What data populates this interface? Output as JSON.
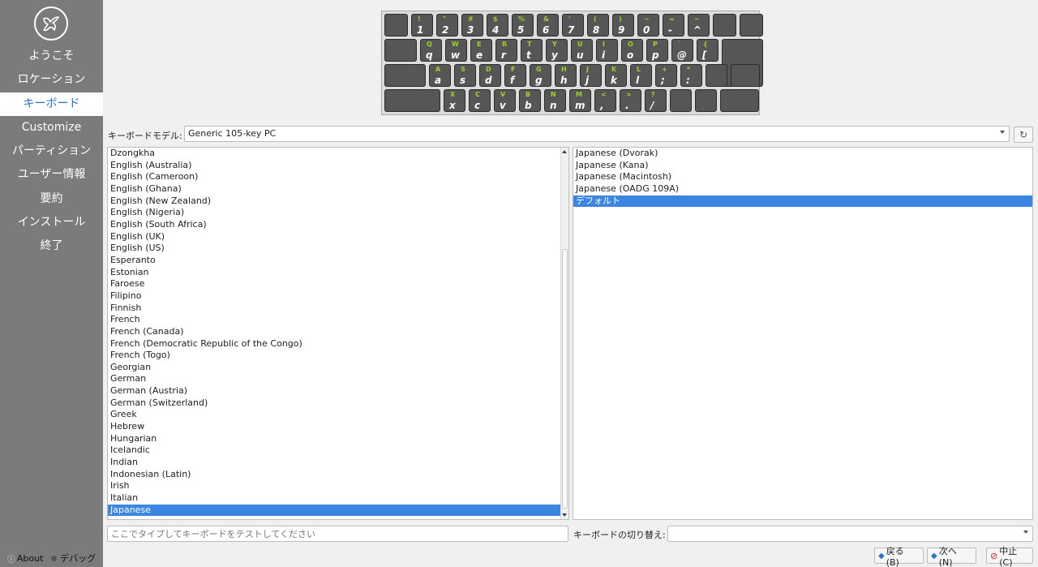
{
  "sidebar": {
    "items": [
      {
        "label": "ようこそ",
        "active": false
      },
      {
        "label": "ロケーション",
        "active": false
      },
      {
        "label": "キーボード",
        "active": true
      },
      {
        "label": "Customize",
        "active": false
      },
      {
        "label": "パーティション",
        "active": false
      },
      {
        "label": "ユーザー情報",
        "active": false
      },
      {
        "label": "要約",
        "active": false
      },
      {
        "label": "インストール",
        "active": false
      },
      {
        "label": "終了",
        "active": false
      }
    ],
    "about_label": "About",
    "debug_label": "デバッグ"
  },
  "keyboard": {
    "rows": [
      [
        [
          "",
          ""
        ],
        [
          "!",
          "1"
        ],
        [
          "\"",
          "2"
        ],
        [
          "#",
          "3"
        ],
        [
          "$",
          "4"
        ],
        [
          "%",
          "5"
        ],
        [
          "&",
          "6"
        ],
        [
          "'",
          "7"
        ],
        [
          "(",
          "8"
        ],
        [
          ")",
          "9"
        ],
        [
          "~",
          "0"
        ],
        [
          "=",
          "-"
        ],
        [
          "~",
          "^"
        ],
        [
          "",
          ""
        ],
        [
          "",
          ""
        ]
      ],
      [
        [
          "",
          ""
        ],
        [
          "Q",
          "q"
        ],
        [
          "W",
          "w"
        ],
        [
          "E",
          "e"
        ],
        [
          "R",
          "r"
        ],
        [
          "T",
          "t"
        ],
        [
          "Y",
          "y"
        ],
        [
          "U",
          "u"
        ],
        [
          "I",
          "i"
        ],
        [
          "O",
          "o"
        ],
        [
          "P",
          "p"
        ],
        [
          "`",
          "@"
        ],
        [
          "{",
          "["
        ],
        [
          "",
          ""
        ]
      ],
      [
        [
          "",
          ""
        ],
        [
          "A",
          "a"
        ],
        [
          "S",
          "s"
        ],
        [
          "D",
          "d"
        ],
        [
          "F",
          "f"
        ],
        [
          "G",
          "g"
        ],
        [
          "H",
          "h"
        ],
        [
          "J",
          "j"
        ],
        [
          "K",
          "k"
        ],
        [
          "L",
          "l"
        ],
        [
          "+",
          ";"
        ],
        [
          "*",
          ":"
        ],
        [
          "",
          ""
        ],
        [
          "",
          ""
        ]
      ],
      [
        [
          "",
          ""
        ],
        [
          "X",
          "x"
        ],
        [
          "C",
          "c"
        ],
        [
          "V",
          "v"
        ],
        [
          "B",
          "b"
        ],
        [
          "N",
          "n"
        ],
        [
          "M",
          "m"
        ],
        [
          "<",
          ","
        ],
        [
          ">",
          "."
        ],
        [
          "?",
          "/"
        ],
        [
          "",
          ""
        ],
        [
          "",
          ""
        ],
        [
          "",
          ""
        ]
      ]
    ]
  },
  "model": {
    "label": "キーボードモデル:",
    "value": "Generic 105-key PC"
  },
  "layouts": [
    "Dzongkha",
    "English (Australia)",
    "English (Cameroon)",
    "English (Ghana)",
    "English (New Zealand)",
    "English (Nigeria)",
    "English (South Africa)",
    "English (UK)",
    "English (US)",
    "Esperanto",
    "Estonian",
    "Faroese",
    "Filipino",
    "Finnish",
    "French",
    "French (Canada)",
    "French (Democratic Republic of the Congo)",
    "French (Togo)",
    "Georgian",
    "German",
    "German (Austria)",
    "German (Switzerland)",
    "Greek",
    "Hebrew",
    "Hungarian",
    "Icelandic",
    "Indian",
    "Indonesian (Latin)",
    "Irish",
    "Italian",
    "Japanese"
  ],
  "selected_layout": "Japanese",
  "variants": [
    "Japanese (Dvorak)",
    "Japanese (Kana)",
    "Japanese (Macintosh)",
    "Japanese (OADG 109A)",
    "デフォルト"
  ],
  "selected_variant": "デフォルト",
  "test_input": {
    "placeholder": "ここでタイプしてキーボードをテストしてください"
  },
  "switch": {
    "label": "キーボードの切り替え:",
    "value": ""
  },
  "buttons": {
    "back": "戻る (B)",
    "next": "次へ (N)",
    "cancel": "中止 (C)"
  },
  "colors": {
    "sidebar_bg": "#7b7b7b",
    "accent": "#3b86e0",
    "key_bg": "#565656",
    "key_shift_text": "#9ed22c"
  }
}
